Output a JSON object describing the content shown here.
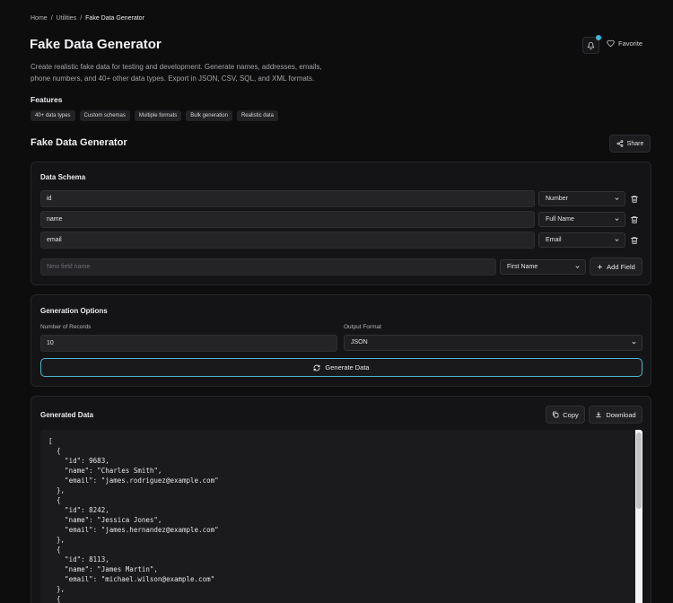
{
  "breadcrumb": {
    "home": "Home",
    "sep": "/",
    "utilities": "Utilities",
    "current": "Fake Data Generator"
  },
  "page": {
    "title": "Fake Data Generator",
    "description": "Create realistic fake data for testing and development. Generate names, addresses, emails, phone numbers, and 40+ other data types. Export in JSON, CSV, SQL, and XML formats.",
    "favorite_label": "Favorite",
    "notification_dot_color": "#3fb6d6"
  },
  "features": {
    "title": "Features",
    "tags": [
      "40+ data types",
      "Custom schemas",
      "Multiple formats",
      "Bulk generation",
      "Realistic data"
    ]
  },
  "tool": {
    "title": "Fake Data Generator",
    "share_label": "Share"
  },
  "schema": {
    "title": "Data Schema",
    "fields": [
      {
        "name": "id",
        "type": "Number"
      },
      {
        "name": "name",
        "type": "Full Name"
      },
      {
        "name": "email",
        "type": "Email"
      }
    ],
    "new_field_placeholder": "New field name",
    "new_field_type": "First Name",
    "add_field_label": "Add Field"
  },
  "options": {
    "title": "Generation Options",
    "records_label": "Number of Records",
    "records_value": "10",
    "format_label": "Output Format",
    "format_value": "JSON",
    "generate_label": "Generate Data",
    "accent_color": "#4fb6cd"
  },
  "output": {
    "title": "Generated Data",
    "copy_label": "Copy",
    "download_label": "Download",
    "lines": [
      "[",
      "  {",
      "    \"id\": 9683,",
      "    \"name\": \"Charles Smith\",",
      "    \"email\": \"james.rodriguez@example.com\"",
      "  },",
      "  {",
      "    \"id\": 8242,",
      "    \"name\": \"Jessica Jones\",",
      "    \"email\": \"james.hernandez@example.com\"",
      "  },",
      "  {",
      "    \"id\": 8113,",
      "    \"name\": \"James Martin\",",
      "    \"email\": \"michael.wilson@example.com\"",
      "  },",
      "  {"
    ]
  }
}
